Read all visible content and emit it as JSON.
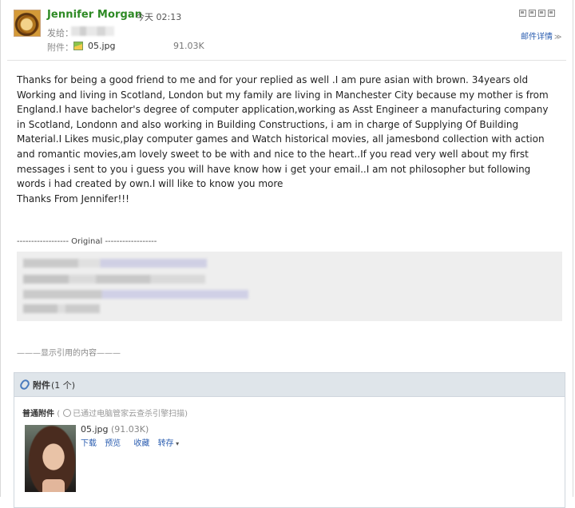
{
  "header": {
    "sender_name": "Jennifer Morgan",
    "time": "今天 02:13",
    "to_label": "发给：",
    "attach_label": "附件：",
    "attach_file_name": "05.jpg",
    "attach_file_size": "91.03K",
    "details_link": "邮件详情",
    "details_chevron": "≫",
    "toolbar_icons": [
      "new-window-icon",
      "print-preview-icon",
      "save-icon",
      "print-icon"
    ]
  },
  "body": {
    "paragraph": "Thanks for being a good friend to me and for your replied as well .I am pure asian with brown. 34years old Working and living in Scotland, London but my family are living in Manchester City because my mother is from England.I have bachelor's degree of computer application,working as Asst Engineer a manufacturing company in Scotland, Londonn and also working in Building Constructions, i am in charge of Supplying Of Building Material.I Likes music,play computer games and Watch historical movies, all jamesbond collection with action and romantic movies,am lovely sweet to be with and nice to the heart..If you read very well about my first messages i sent to you i guess you will have know how i get your email..I am not philosopher but following words i had created by own.I will like to know you more",
    "signoff": "Thanks From Jennifer!!!"
  },
  "quote": {
    "original_line": "------------------ Original ------------------",
    "show_quoted": "———显示引用的内容———"
  },
  "attachments": {
    "title": "附件",
    "count": "(1 个)",
    "section_label": "普通附件",
    "scan_note": "已通过电脑管家云查杀引擎扫描",
    "scan_note_open": "(",
    "scan_note_close": ")",
    "file_name": "05.jpg",
    "file_size": "(91.03K)",
    "actions": [
      "下载",
      "预览",
      "收藏",
      "转存"
    ]
  }
}
